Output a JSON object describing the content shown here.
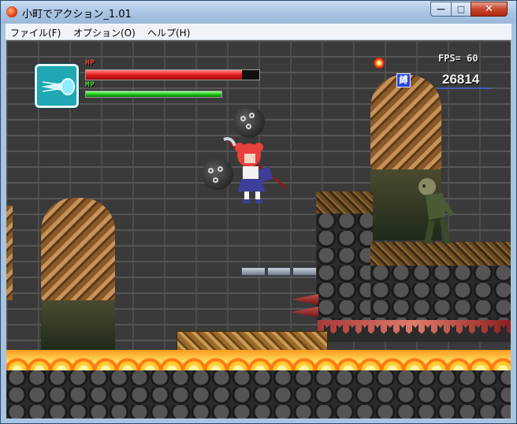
{
  "window": {
    "title": "小町でアクション_1.01",
    "controls": {
      "minimize": "—",
      "maximize": "□",
      "close": "✕"
    }
  },
  "menu": {
    "items": [
      {
        "label": "ファイル(F)"
      },
      {
        "label": "オプション(O)"
      },
      {
        "label": "ヘルプ(H)"
      }
    ]
  },
  "hud": {
    "hp_label": "HP",
    "mp_label": "MP",
    "hp_fraction": 0.9,
    "mp_fraction": 1.0,
    "fps_text": "FPS=  60",
    "score": "26814",
    "status_icon": "縛",
    "weapon_icon": "scythe-wave-icon"
  },
  "colors": {
    "hp": "#e11a1a",
    "mp": "#22c81a",
    "weapon_box": "#1fa7b3",
    "lava": "#ff9a20"
  }
}
